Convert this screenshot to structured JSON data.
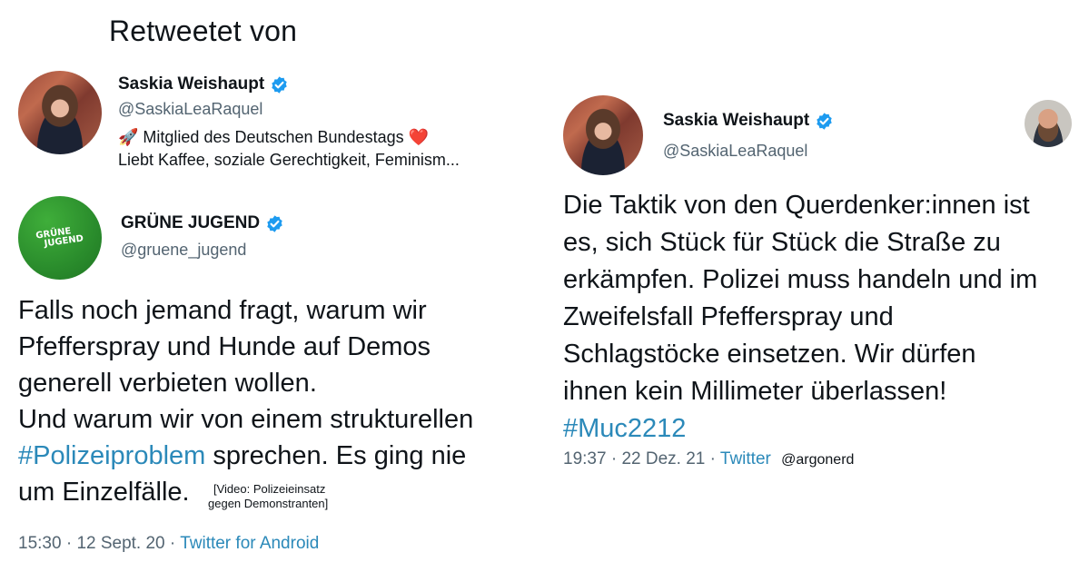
{
  "left": {
    "heading": "Retweetet von",
    "retweeter": {
      "name": "Saskia Weishaupt",
      "handle": "@SaskiaLeaRaquel",
      "bio_line1": "🚀 Mitglied des Deutschen Bundestags ❤️",
      "bio_line2": "Liebt Kaffee, soziale Gerechtigkeit, Feminism..."
    },
    "author": {
      "name": "GRÜNE JUGEND",
      "handle": "@gruene_jugend",
      "logo_text_line1": "GRÜNE",
      "logo_text_line2": "JUGEND"
    },
    "tweet": {
      "line1": "Falls noch jemand fragt, warum wir",
      "line2": "Pfefferspray und Hunde auf Demos",
      "line3": "generell verbieten wollen.",
      "line4": "Und warum wir von einem strukturellen",
      "hashtag": "#Polizeiproblem",
      "line5_rest": " sprechen. Es ging nie",
      "line6": "um Einzelfälle.",
      "caption_line1": "[Video: Polizeieinsatz",
      "caption_line2": "gegen Demonstranten]"
    },
    "meta": {
      "time": "15:30",
      "sep1": " · ",
      "date": "12 Sept. 20",
      "sep2": " · ",
      "source": "Twitter for Android"
    }
  },
  "right": {
    "author": {
      "name": "Saskia Weishaupt",
      "handle": "@SaskiaLeaRaquel"
    },
    "tweet": {
      "line1": "Die Taktik von den Querdenker:innen ist",
      "line2": "es, sich Stück für Stück die Straße zu",
      "line3": "erkämpfen. Polizei muss handeln und im",
      "line4": "Zweifelsfall Pfefferspray und",
      "line5": "Schlagstöcke einsetzen. Wir dürfen",
      "line6": "ihnen kein Millimeter überlassen!",
      "hashtag": "#Muc2212"
    },
    "meta": {
      "time": "19:37",
      "sep1": " · ",
      "date": "22 Dez. 21",
      "sep2": " · ",
      "source": "Twitter",
      "credit": "@argonerd"
    }
  },
  "colors": {
    "text": "#0f1419",
    "secondary": "#536471",
    "link": "#2b89b9",
    "verified": "#1d9bf0",
    "green": "#2a8c2c"
  },
  "icons": [
    "verified-badge-icon",
    "rocket-emoji-icon",
    "heart-emoji-icon"
  ]
}
